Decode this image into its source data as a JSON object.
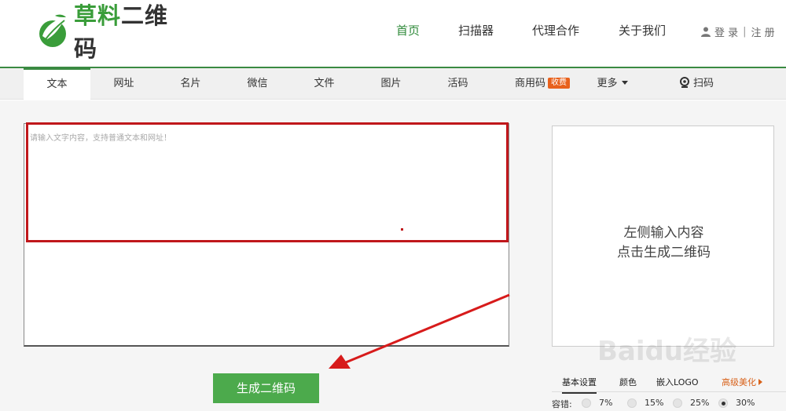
{
  "logo": {
    "text_green": "草料",
    "text_dark": "二维码"
  },
  "nav": [
    {
      "label": "首页",
      "active": true
    },
    {
      "label": "扫描器"
    },
    {
      "label": "代理合作"
    },
    {
      "label": "关于我们"
    }
  ],
  "auth": {
    "login": "登 录",
    "register": "注 册"
  },
  "tabs": {
    "text": "文本",
    "url": "网址",
    "card": "名片",
    "wechat": "微信",
    "file": "文件",
    "image": "图片",
    "live": "活码",
    "commercial": "商用码",
    "commercial_badge": "收费",
    "more": "更多",
    "scan": "扫码"
  },
  "editor": {
    "placeholder": "请输入文字内容，支持普通文本和网址！"
  },
  "qr_preview": {
    "line1": "左侧输入内容",
    "line2": "点击生成二维码"
  },
  "generate_button": "生成二维码",
  "settings": {
    "tabs": [
      "基本设置",
      "颜色",
      "嵌入LOGO",
      "高级美化"
    ],
    "ecc_label": "容错:",
    "ecc_options": [
      "7%",
      "15%",
      "25%",
      "30%"
    ],
    "ecc_selected": "30%"
  },
  "watermark": "Baidu经验",
  "colors": {
    "brand_green": "#3a8a42",
    "button_green": "#4caa4c",
    "highlight_red": "#c0171b",
    "badge_orange": "#e8611c"
  }
}
